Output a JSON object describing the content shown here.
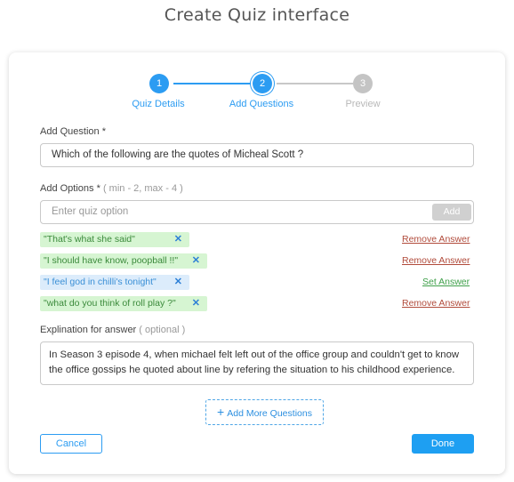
{
  "page": {
    "title": "Create Quiz interface"
  },
  "stepper": {
    "steps": [
      {
        "number": "1",
        "label": "Quiz Details"
      },
      {
        "number": "2",
        "label": "Add Questions"
      },
      {
        "number": "3",
        "label": "Preview"
      }
    ]
  },
  "question": {
    "label": "Add Question *",
    "value": "Which of the following are the quotes of Micheal Scott ?"
  },
  "options": {
    "label": "Add Options *",
    "hint": "( min - 2, max - 4 )",
    "placeholder": "Enter quiz option",
    "add_label": "Add",
    "items": [
      {
        "text": "\"That's what she said\"",
        "action": "Remove Answer"
      },
      {
        "text": "\"I should have know, poopball !!\"",
        "action": "Remove Answer"
      },
      {
        "text": "\"I feel god in chilli's tonight\"",
        "action": "Set Answer"
      },
      {
        "text": "\"what do you think of roll play ?\"",
        "action": "Remove Answer"
      }
    ]
  },
  "explanation": {
    "label": "Explination for answer",
    "hint": "( optional )",
    "value": "In Season 3 episode 4, when michael felt left out of the office group and couldn't get to know the office gossips he quoted about line by refering the situation to his childhood experience."
  },
  "add_more_label": "Add More Questions",
  "footer": {
    "cancel_label": "Cancel",
    "done_label": "Done"
  },
  "colors": {
    "accent": "#2c9cf2",
    "remove": "#b14b3b",
    "set": "#3fa04a",
    "correct_bg": "#d6f5d2",
    "option_bg": "#dcecfb"
  },
  "icons": {
    "remove_option": "close-icon",
    "add_more": "plus-icon"
  }
}
